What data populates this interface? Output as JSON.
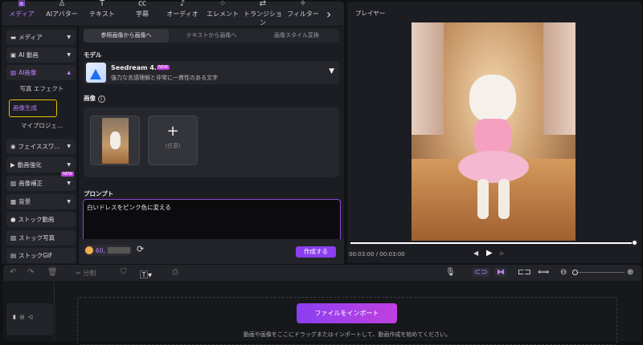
{
  "topnav": {
    "items": [
      {
        "label": "メディア",
        "icon": "media-icon",
        "glyph": "▣"
      },
      {
        "label": "AIアバター",
        "icon": "avatar-icon",
        "glyph": "♙"
      },
      {
        "label": "テキスト",
        "icon": "text-icon",
        "glyph": "T"
      },
      {
        "label": "字幕",
        "icon": "caption-icon",
        "glyph": "㏄"
      },
      {
        "label": "オーディオ",
        "icon": "audio-icon",
        "glyph": "♪"
      },
      {
        "label": "エレメント",
        "icon": "element-icon",
        "glyph": "⁘"
      },
      {
        "label": "トランジション",
        "icon": "transition-icon",
        "glyph": "⇄"
      },
      {
        "label": "フィルター",
        "icon": "filter-icon",
        "glyph": "✧"
      }
    ],
    "more": "›"
  },
  "sidebar": {
    "items": [
      {
        "label": "メディア",
        "glyph": "▬"
      },
      {
        "label": "AI 動画",
        "glyph": "▣"
      },
      {
        "label": "AI画像",
        "glyph": "▨"
      },
      {
        "label": "写真 エフェクト"
      },
      {
        "label": "画像生成"
      },
      {
        "label": "マイプロジェ..."
      },
      {
        "label": "フェイススワ...",
        "glyph": "◉"
      },
      {
        "label": "動画強化",
        "glyph": "▶"
      },
      {
        "label": "画像補正",
        "glyph": "▨",
        "badge": "NEW"
      },
      {
        "label": "背景",
        "glyph": "▩"
      },
      {
        "label": "ストック動画",
        "glyph": "●"
      },
      {
        "label": "ストック写真",
        "glyph": "▨"
      },
      {
        "label": "ストックGIF",
        "glyph": "▤"
      }
    ]
  },
  "content": {
    "tabs": [
      "参照画像から画像へ",
      "テキストから画像へ",
      "画像スタイル変換"
    ],
    "model_label": "モデル",
    "model_name": "Seedream 4.0",
    "model_badge": "NEW",
    "model_desc": "強力な言語理解と非常に一貫性のある文字",
    "image_label": "画像",
    "optional": "(任意)",
    "prompt_label": "プロンプト",
    "prompt_value": "白いドレスをピンク色に変える",
    "credits": "60,",
    "create": "作成する"
  },
  "player": {
    "title": "プレイヤー",
    "time": "00:03:00 / 00:03:00",
    "progress": 1.0
  },
  "timeline": {
    "split": "分割",
    "import": "ファイルをインポート",
    "hint": "動画や画像をここにドラッグまたはインポートして、動画作成を始めてください。"
  },
  "colors": {
    "accent": "#a855f7",
    "highlight": "#e6c200"
  }
}
